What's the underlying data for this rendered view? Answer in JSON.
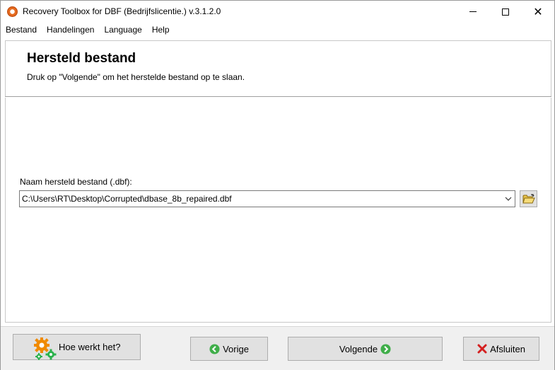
{
  "window": {
    "title": "Recovery Toolbox for DBF (Bedrijfslicentie.) v.3.1.2.0",
    "icon": "app-logo-icon",
    "controls": [
      "minimize-icon",
      "maximize-icon",
      "close-icon"
    ]
  },
  "menu": {
    "items": [
      "Bestand",
      "Handelingen",
      "Language",
      "Help"
    ]
  },
  "header": {
    "title": "Hersteld bestand",
    "subtitle": "Druk op \"Volgende\" om het herstelde bestand op te slaan."
  },
  "content": {
    "field_label": "Naam hersteld bestand (.dbf):",
    "file_path": "C:\\Users\\RT\\Desktop\\Corrupted\\dbase_8b_repaired.dbf",
    "browse_icon": "open-folder-icon",
    "dropdown_icon": "chevron-down-icon"
  },
  "buttons": {
    "how_it_works": "Hoe werkt het?",
    "previous": "Vorige",
    "next": "Volgende",
    "exit": "Afsluiten"
  },
  "colors": {
    "gear_orange": "#f08a00",
    "gear_green": "#2bb24c",
    "arrow_green": "#3fae49",
    "exit_red": "#d42020",
    "folder_yellow": "#e8c34a"
  }
}
